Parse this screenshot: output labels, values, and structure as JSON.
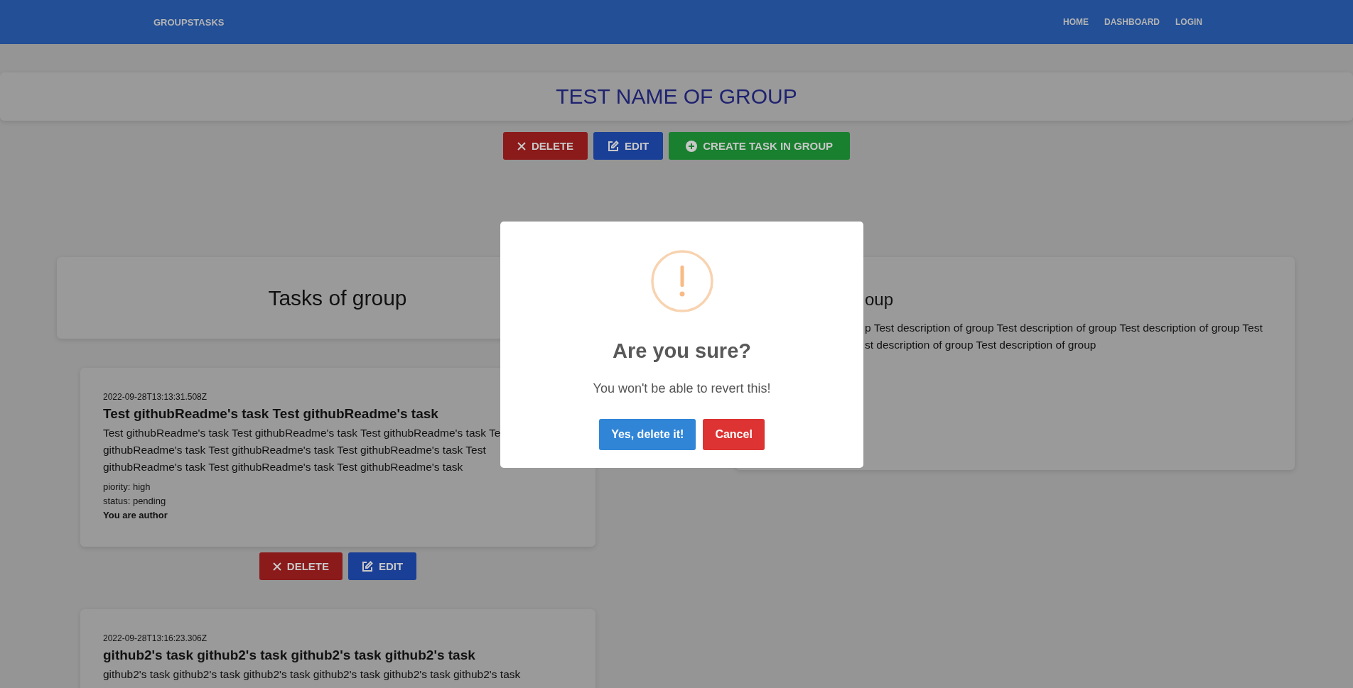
{
  "navbar": {
    "brand": "GROUPSTASKS",
    "links": [
      "HOME",
      "DASHBOARD",
      "LOGIN"
    ]
  },
  "group": {
    "title": "TEST NAME OF GROUP",
    "actions": [
      {
        "kind": "delete",
        "label": "DELETE"
      },
      {
        "kind": "edit",
        "label": "EDIT"
      },
      {
        "kind": "create",
        "label": "CREATE TASK IN GROUP"
      }
    ]
  },
  "tasks_panel": {
    "title": "Tasks of group",
    "tasks": [
      {
        "timestamp": "2022-09-28T13:13:31.508Z",
        "title": "Test githubReadme's task Test githubReadme's task",
        "description_lines": [
          "Test githubReadme's task Test githubReadme's task Test githubReadme's task Te",
          "githubReadme's task Test githubReadme's task Test githubReadme's task Test",
          "githubReadme's task Test githubReadme's task Test githubReadme's task"
        ],
        "meta": [
          "piority: high",
          "status: pending"
        ],
        "author_note": "You are author",
        "actions": [
          {
            "kind": "delete",
            "label": "DELETE"
          },
          {
            "kind": "edit",
            "label": "EDIT"
          }
        ]
      },
      {
        "timestamp": "2022-09-28T13:16:23.306Z",
        "title": "github2's task github2's task github2's task github2's task",
        "description_lines": [
          "github2's task github2's task github2's task github2's task github2's task github2's task"
        ]
      }
    ]
  },
  "description_panel": {
    "title": "oup",
    "description_lines": [
      "p Test description of group Test description of group Test description of group Test",
      "st description of group Test description of group"
    ]
  },
  "dialog": {
    "title": "Are you sure?",
    "text": "You won't be able to revert this!",
    "buttons": [
      {
        "kind": "confirm",
        "label": "Yes, delete it!"
      },
      {
        "kind": "cancel",
        "label": "Cancel"
      }
    ]
  }
}
